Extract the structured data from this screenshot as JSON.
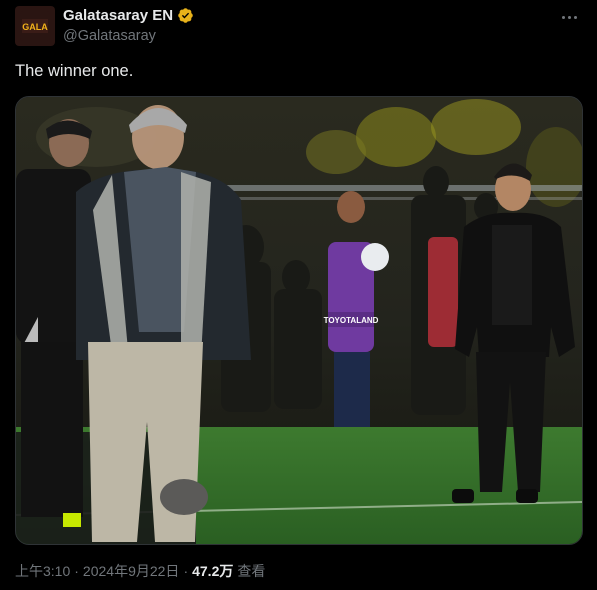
{
  "account": {
    "display_name": "Galatasaray EN",
    "handle": "@Galatasaray",
    "avatar_text": "GALA"
  },
  "tweet": {
    "text": "The winner one.",
    "time": "上午3:10",
    "date": "2024年9月22日",
    "views_count": "47.2万",
    "views_label": "查看"
  },
  "photo": {
    "banner_text": "TOYOTALAND"
  },
  "colors": {
    "background": "#000000",
    "text_primary": "#e7e9ea",
    "text_secondary": "#71767b",
    "verified": "#e8b21a",
    "pitch": "#2f6b2a"
  }
}
